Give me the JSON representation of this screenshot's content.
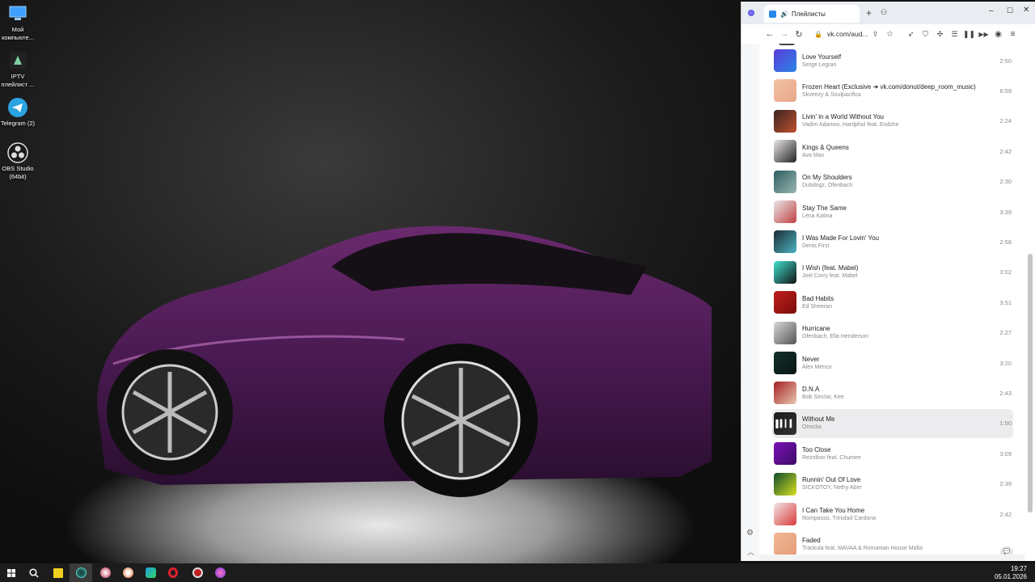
{
  "desktop": {
    "icons": [
      {
        "label": "Мой компьюте...",
        "icon": "computer-icon"
      },
      {
        "label": "IPTV плейлист ...",
        "icon": "iptv-icon"
      },
      {
        "label": "Telegram (2)",
        "icon": "telegram-icon"
      },
      {
        "label": "OBS Studio (64bit)",
        "icon": "obs-icon"
      }
    ]
  },
  "browser": {
    "tab_title": "Плейлисты",
    "url": "vk.com/aud...",
    "accent": "#2688eb"
  },
  "tracks": [
    {
      "title": "Love Yourself",
      "artist": "Serge Legran",
      "duration": "2:50",
      "cover": "#5a3bd6",
      "cover2": "#2a86e8"
    },
    {
      "title": "Frozen Heart (Exclusive ➜ vk.com/donut/deep_room_music)",
      "artist": "Skveezy & Soulpacifica",
      "duration": "6:59",
      "cover": "#f3c2a6",
      "cover2": "#e8a688"
    },
    {
      "title": "Livin' in a World Without You",
      "artist": "Vadim Adamov, Hardphol feat. Endzhe",
      "duration": "2:24",
      "cover": "#3a2420",
      "cover2": "#c05030"
    },
    {
      "title": "Kings & Queens",
      "artist": "Ava Max",
      "duration": "2:42",
      "cover": "#eae6e6",
      "cover2": "#222222"
    },
    {
      "title": "On My Shoulders",
      "artist": "Dubdogz, Ofenbach",
      "duration": "2:30",
      "cover": "#2d5d62",
      "cover2": "#9bb8b0"
    },
    {
      "title": "Stay The Same",
      "artist": "Lena Katina",
      "duration": "3:39",
      "cover": "#e8e8e8",
      "cover2": "#c24040"
    },
    {
      "title": "I Was Made For Lovin' You",
      "artist": "Denis First",
      "duration": "2:58",
      "cover": "#1d2b33",
      "cover2": "#4ab3c2"
    },
    {
      "title": "I Wish (feat. Mabel)",
      "artist": "Joel Corry feat. Mabel",
      "duration": "3:02",
      "cover": "#42e0cf",
      "cover2": "#111111"
    },
    {
      "title": "Bad Habits",
      "artist": "Ed Sheeran",
      "duration": "3:51",
      "cover": "#c0201c",
      "cover2": "#7a0c0c"
    },
    {
      "title": "Hurricane",
      "artist": "Ofenbach, Ella Henderson",
      "duration": "2:27",
      "cover": "#d8d8d8",
      "cover2": "#555555"
    },
    {
      "title": "Never",
      "artist": "Alex Menco",
      "duration": "3:20",
      "cover": "#14302c",
      "cover2": "#0a1614"
    },
    {
      "title": "D.N.A",
      "artist": "Bob Sinclar, Kee",
      "duration": "2:43",
      "cover": "#a51e22",
      "cover2": "#e8c8b0"
    },
    {
      "title": "Without Me",
      "artist": "Otnicka",
      "duration": "1:50",
      "cover": "#1a1a1a",
      "cover2": "#333333"
    },
    {
      "title": "Too Close",
      "artist": "Reznikov feat. Chumee",
      "duration": "3:09",
      "cover": "#7a12b8",
      "cover2": "#3d0a66"
    },
    {
      "title": "Runnin' Out Of Love",
      "artist": "SICKOTOY, Nethy Aber",
      "duration": "2:39",
      "cover": "#0d4a2a",
      "cover2": "#d8e020"
    },
    {
      "title": "I Can Take You Home",
      "artist": "Rompasso, Trinidad Cardona",
      "duration": "2:42",
      "cover": "#f4e6e6",
      "cover2": "#d83a3a"
    },
    {
      "title": "Faded",
      "artist": "Trackula feat. MAVAA & Romanian House Mafia",
      "duration": "",
      "cover": "#f1b894",
      "cover2": "#e49c78"
    }
  ],
  "playing_index": 12,
  "taskbar": {
    "time": "19:27",
    "date": "05.01.2026"
  }
}
